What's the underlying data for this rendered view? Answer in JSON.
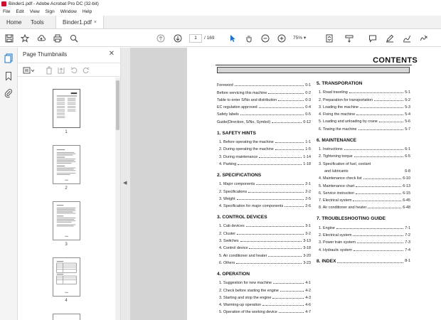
{
  "window": {
    "title": "Binder1.pdf - Adobe Acrobat Pro DC (32-bit)"
  },
  "menu": [
    "File",
    "Edit",
    "View",
    "Sign",
    "Window",
    "Help"
  ],
  "tabs": {
    "home": "Home",
    "tools": "Tools",
    "doc": "Binder1.pdf",
    "close": "×"
  },
  "toolbar": {
    "page_current": "1",
    "page_total": "/ 169",
    "zoom": "75%"
  },
  "thumbnails": {
    "title": "Page Thumbnails",
    "close": "✕",
    "pages": [
      "1",
      "2",
      "3",
      "4"
    ]
  },
  "document": {
    "heading": "CONTENTS",
    "left": [
      {
        "head": "",
        "entries": [
          {
            "t": "Foreword",
            "p": "0-1"
          },
          {
            "t": "Before servicing this machine",
            "p": "0-2"
          },
          {
            "t": "Table to enter S/No and distribution",
            "p": "0-3"
          },
          {
            "t": "EC regulation approved",
            "p": "0-4"
          },
          {
            "t": "Safety labels",
            "p": "0-5"
          },
          {
            "t": "Guide(Direction, S/No, Symbol)",
            "p": "0-12"
          }
        ]
      },
      {
        "head": "1. SAFETY HINTS",
        "entries": [
          {
            "t": "1. Before operating the machine",
            "p": "1-1"
          },
          {
            "t": "2. During operating the machine",
            "p": "1-5"
          },
          {
            "t": "3. During maintenance",
            "p": "1-14"
          },
          {
            "t": "4. Parking",
            "p": "1-18"
          }
        ]
      },
      {
        "head": "2. SPECIFICATIONS",
        "entries": [
          {
            "t": "1. Major components",
            "p": "2-1"
          },
          {
            "t": "2. Specifications",
            "p": "2-2"
          },
          {
            "t": "3. Weight",
            "p": "2-5"
          },
          {
            "t": "4. Specification for major components",
            "p": "2-6"
          }
        ]
      },
      {
        "head": "3. CONTROL DEVICES",
        "entries": [
          {
            "t": "1. Cab devices",
            "p": "3-1"
          },
          {
            "t": "2. Cluster",
            "p": "3-2"
          },
          {
            "t": "3. Switches",
            "p": "3-13"
          },
          {
            "t": "4. Control device",
            "p": "3-18"
          },
          {
            "t": "5. Air conditioner and heater",
            "p": "3-20"
          },
          {
            "t": "6. Others",
            "p": "3-23"
          }
        ]
      },
      {
        "head": "4. OPERATION",
        "entries": [
          {
            "t": "1. Suggestion for new machine",
            "p": "4-1"
          },
          {
            "t": "2. Check before starting the engine",
            "p": "4-2"
          },
          {
            "t": "3. Starting and stop the engine",
            "p": "4-3"
          },
          {
            "t": "4. Warming-up operation",
            "p": "4-6"
          },
          {
            "t": "5. Operation of the working device",
            "p": "4-7"
          }
        ]
      }
    ],
    "right": [
      {
        "head": "5. TRANSPORATION",
        "entries": [
          {
            "t": "1. Road traveling",
            "p": "5-1"
          },
          {
            "t": "2. Preparation for transportation",
            "p": "5-2"
          },
          {
            "t": "3. Loading the machine",
            "p": "5-3"
          },
          {
            "t": "4. Fixing the machine",
            "p": "5-4"
          },
          {
            "t": "5. Loading and unloading by crane",
            "p": "5-6"
          },
          {
            "t": "6. Towing the machine",
            "p": "5-7"
          }
        ]
      },
      {
        "head": "6. MAINTENANCE",
        "entries": [
          {
            "t": "1. Instructions",
            "p": "6-1"
          },
          {
            "t": "2. Tightening torque",
            "p": "6-5"
          },
          {
            "t": "3. Specification of fuel, coolant",
            "p": ""
          },
          {
            "t": "and lubricants",
            "p": "6-8",
            "cont": true
          },
          {
            "t": "4. Maintenance check list",
            "p": "6-10"
          },
          {
            "t": "5. Maintenance chart",
            "p": "6-13"
          },
          {
            "t": "6. Service instruction",
            "p": "6-15"
          },
          {
            "t": "7. Electrical system",
            "p": "6-45"
          },
          {
            "t": "8. Air conditioner and heater",
            "p": "6-48"
          }
        ]
      },
      {
        "head": "7. TROUBLESHOOTING GUIDE",
        "entries": [
          {
            "t": "1. Engine",
            "p": "7-1"
          },
          {
            "t": "2. Electrical system",
            "p": "7-2"
          },
          {
            "t": "3. Power train system",
            "p": "7-3"
          },
          {
            "t": "4. Hydraulic system",
            "p": "7-4"
          }
        ]
      },
      {
        "head": "8. INDEX",
        "entries": [],
        "inline_page": "8-1"
      }
    ]
  }
}
